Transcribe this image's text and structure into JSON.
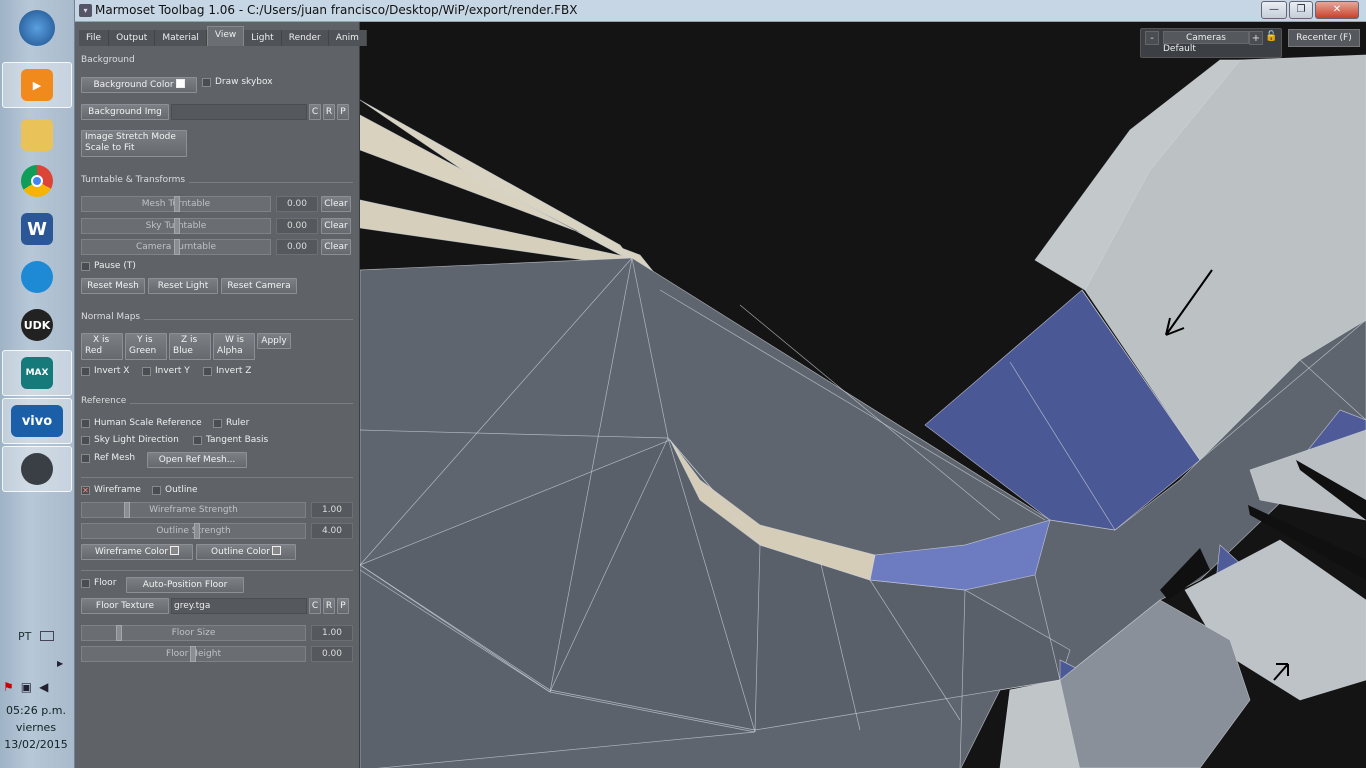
{
  "window": {
    "title": "Marmoset Toolbag 1.06 - C:/Users/juan francisco/Desktop/WiP/export/render.FBX",
    "minimize": "—",
    "maximize": "❐",
    "close": "✕"
  },
  "taskbar": {
    "items": [
      {
        "name": "windows-start",
        "label": ""
      },
      {
        "name": "media-player",
        "label": ""
      },
      {
        "name": "file-explorer",
        "label": ""
      },
      {
        "name": "chrome",
        "label": ""
      },
      {
        "name": "word",
        "label": "W"
      },
      {
        "name": "app-blue",
        "label": ""
      },
      {
        "name": "udk",
        "label": "UDK"
      },
      {
        "name": "3ds-max",
        "label": "MAX"
      },
      {
        "name": "vivo",
        "label": "vivo"
      },
      {
        "name": "marmoset",
        "label": ""
      }
    ],
    "language": "PT",
    "time": "05:26 p.m.",
    "day": "viernes",
    "date": "13/02/2015"
  },
  "tabs": [
    "File",
    "Output",
    "Material",
    "View",
    "Light",
    "Render",
    "Anim"
  ],
  "background": {
    "section": "Background",
    "bg_color_label": "Background Color",
    "draw_skybox_label": "Draw skybox",
    "bg_img_label": "Background Img",
    "btn_c": "C",
    "btn_r": "R",
    "btn_p": "P",
    "stretch_line1": "Image Stretch Mode",
    "stretch_line2": "Scale to Fit"
  },
  "turntable": {
    "section": "Turntable & Transforms",
    "mesh_label": "Mesh Turntable",
    "sky_label": "Sky Turntable",
    "camera_label": "Camera Turntable",
    "mesh_value": "0.00",
    "sky_value": "0.00",
    "camera_value": "0.00",
    "clear": "Clear",
    "pause_label": "Pause (T)",
    "reset_mesh": "Reset Mesh",
    "reset_light": "Reset Light",
    "reset_camera": "Reset Camera"
  },
  "normal_maps": {
    "section": "Normal Maps",
    "x1": "X is",
    "x2": "Red",
    "y1": "Y is",
    "y2": "Green",
    "z1": "Z is",
    "z2": "Blue",
    "w1": "W is",
    "w2": "Alpha",
    "apply": "Apply",
    "invert_x": "Invert X",
    "invert_y": "Invert Y",
    "invert_z": "Invert Z"
  },
  "reference": {
    "section": "Reference",
    "human_scale": "Human Scale Reference",
    "ruler": "Ruler",
    "sky_light_dir": "Sky Light Direction",
    "tangent_basis": "Tangent Basis",
    "ref_mesh": "Ref Mesh",
    "open_ref_mesh": "Open Ref Mesh..."
  },
  "wireframe": {
    "wireframe_label": "Wireframe",
    "wireframe_checked": "✕",
    "outline_label": "Outline",
    "wire_strength_label": "Wireframe Strength",
    "wire_strength_value": "1.00",
    "outline_strength_label": "Outline Strength",
    "outline_strength_value": "4.00",
    "wire_color_label": "Wireframe Color",
    "outline_color_label": "Outline Color"
  },
  "floor": {
    "floor_label": "Floor",
    "auto_position": "Auto-Position Floor",
    "texture_label": "Floor Texture",
    "texture_value": "grey.tga",
    "size_label": "Floor Size",
    "size_value": "1.00",
    "height_label": "Floor Height",
    "height_value": "0.00"
  },
  "camera": {
    "minus": "-",
    "label": "Cameras",
    "plus": "+",
    "lock": "🔓",
    "value": "Default",
    "recenter": "Recenter (F)"
  },
  "colors": {
    "mesh_grey": "#5f6670",
    "mesh_light": "#bfc5c7",
    "mesh_cream": "#d9d3c2",
    "mesh_blue": "#4e5b98"
  }
}
